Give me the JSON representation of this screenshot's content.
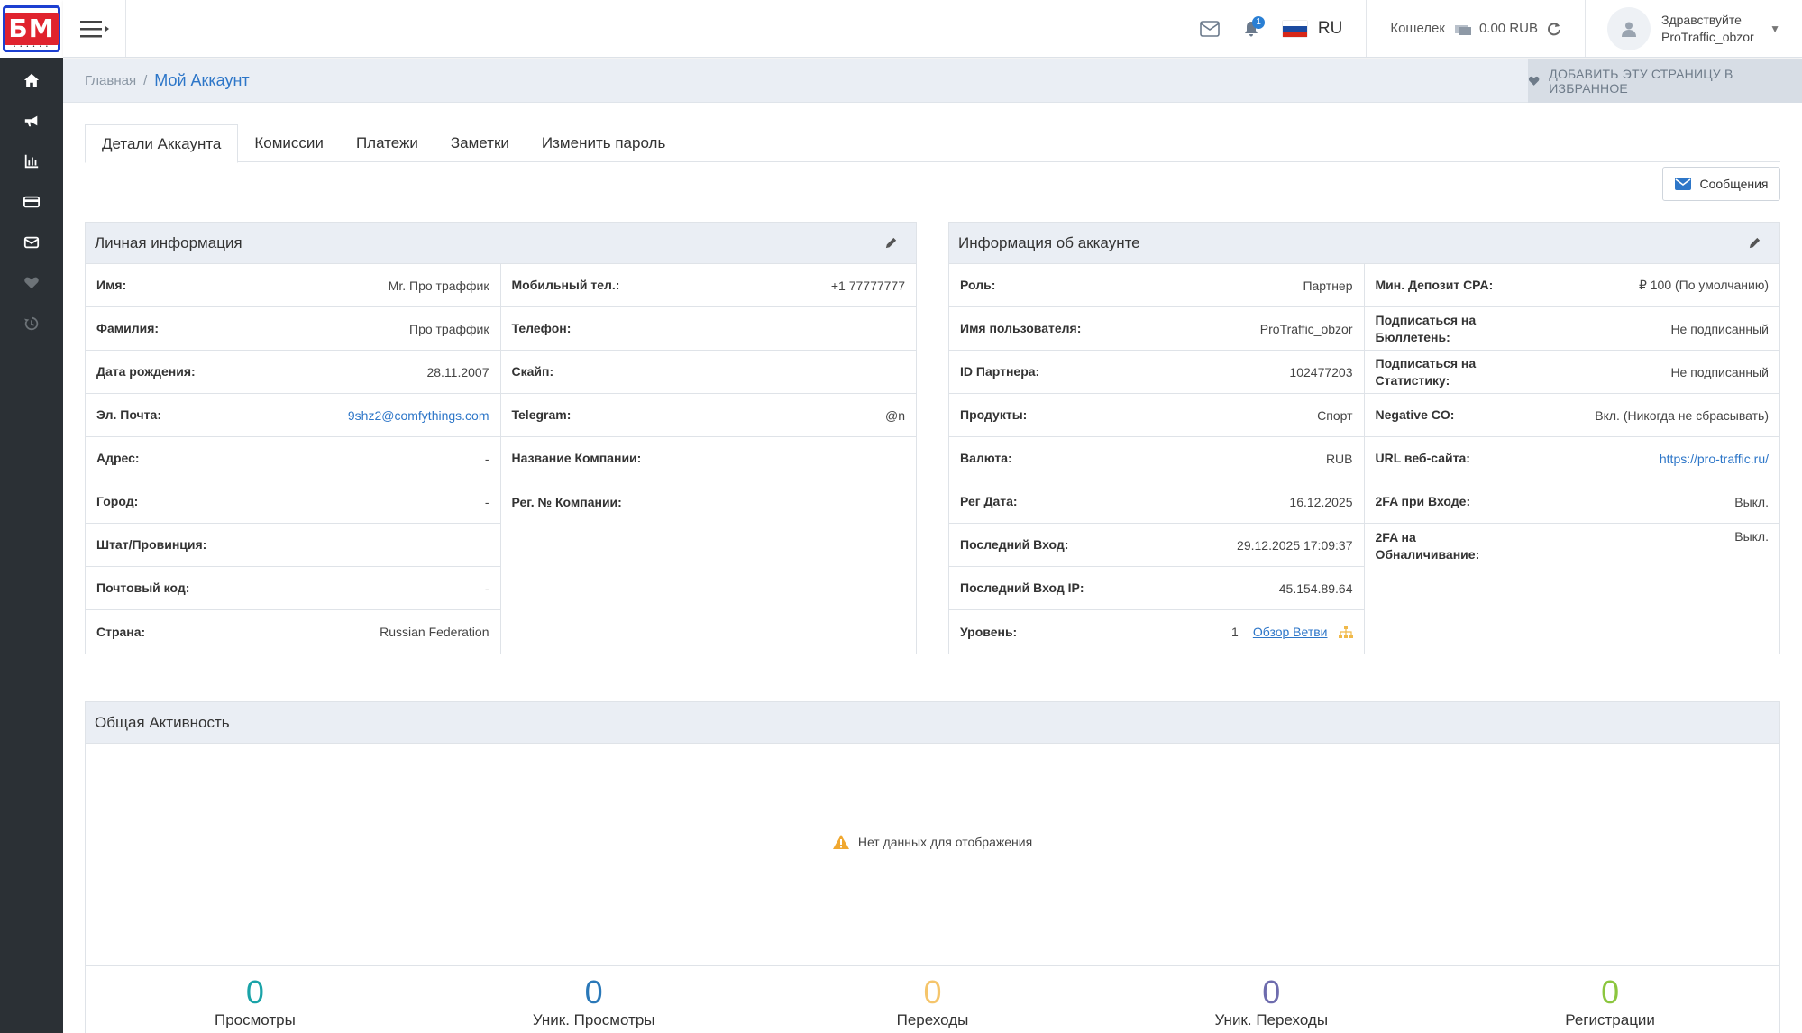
{
  "header": {
    "lang": "RU",
    "notification_count": "1",
    "wallet_label": "Кошелек",
    "wallet_value": "0.00 RUB",
    "greeting": "Здравствуйте",
    "username": "ProTraffic_obzor"
  },
  "logo": {
    "letters": "БМ"
  },
  "breadcrumb": {
    "home": "Главная",
    "separator": "/",
    "current": "Мой Аккаунт"
  },
  "favorite_button": "ДОБАВИТЬ ЭТУ СТРАНИЦУ В ИЗБРАННОЕ",
  "tabs": [
    "Детали Аккаунта",
    "Комиссии",
    "Платежи",
    "Заметки",
    "Изменить пароль"
  ],
  "messages_button": "Сообщения",
  "personal": {
    "title": "Личная информация",
    "left": [
      {
        "label": "Имя:",
        "value": "Mr. Про траффик"
      },
      {
        "label": "Фамилия:",
        "value": "Про траффик"
      },
      {
        "label": "Дата рождения:",
        "value": "28.11.2007"
      },
      {
        "label": "Эл. Почта:",
        "value": "9shz2@comfythings.com"
      },
      {
        "label": "Адрес:",
        "value": "-"
      },
      {
        "label": "Город:",
        "value": "-"
      },
      {
        "label": "Штат/Провинция:",
        "value": ""
      },
      {
        "label": "Почтовый код:",
        "value": "-"
      },
      {
        "label": "Страна:",
        "value": "Russian Federation"
      }
    ],
    "right": [
      {
        "label": "Мобильный тел.:",
        "value": "+1 77777777"
      },
      {
        "label": "Телефон:",
        "value": ""
      },
      {
        "label": "Скайп:",
        "value": ""
      },
      {
        "label": "Telegram:",
        "value": "@n"
      },
      {
        "label": "Название Компании:",
        "value": ""
      },
      {
        "label": "Рег. № Компании:",
        "value": ""
      }
    ]
  },
  "account": {
    "title": "Информация об аккаунте",
    "left": [
      {
        "label": "Роль:",
        "value": "Партнер"
      },
      {
        "label": "Имя пользователя:",
        "value": "ProTraffic_obzor"
      },
      {
        "label": "ID Партнера:",
        "value": "102477203"
      },
      {
        "label": "Продукты:",
        "value": "Спорт"
      },
      {
        "label": "Валюта:",
        "value": "RUB"
      },
      {
        "label": "Рег Дата:",
        "value": "16.12.2025"
      },
      {
        "label": "Последний Вход:",
        "value": "29.12.2025 17:09:37"
      },
      {
        "label": "Последний Вход IP:",
        "value": "45.154.89.64"
      }
    ],
    "level": {
      "label": "Уровень:",
      "value": "1",
      "link": "Обзор Ветви"
    },
    "right": [
      {
        "label": "Мин. Депозит CPA:",
        "value": "₽ 100 (По умолчанию)"
      },
      {
        "label": "Подписаться на Бюллетень:",
        "value": "Не подписанный"
      },
      {
        "label": "Подписаться на Статистику:",
        "value": "Не подписанный"
      },
      {
        "label": "Negative CO:",
        "value": "Вкл. (Никогда не сбрасывать)"
      },
      {
        "label": "URL веб-сайта:",
        "value": "https://pro-traffic.ru/"
      },
      {
        "label": "2FA при Входе:",
        "value": "Выкл."
      },
      {
        "label": "2FA на Обналичивание:",
        "value": "Выкл."
      }
    ]
  },
  "activity": {
    "title": "Общая Активность",
    "no_data": "Нет данных для отображения",
    "stats": [
      {
        "value": "0",
        "label": "Просмотры",
        "color": "#1aa3a8"
      },
      {
        "value": "0",
        "label": "Уник. Просмотры",
        "color": "#2a78b8"
      },
      {
        "value": "0",
        "label": "Переходы",
        "color": "#f5c56b"
      },
      {
        "value": "0",
        "label": "Уник. Переходы",
        "color": "#6e6cae"
      },
      {
        "value": "0",
        "label": "Регистрации",
        "color": "#8cc63f"
      }
    ]
  },
  "sidebar": {
    "items": [
      "home-icon",
      "bullhorn-icon",
      "bar-chart-icon",
      "credit-card-icon",
      "envelope-icon",
      "heart-icon",
      "history-icon"
    ]
  }
}
